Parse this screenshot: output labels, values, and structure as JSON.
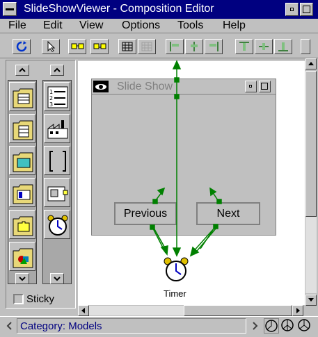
{
  "window": {
    "title": "SlideShowViewer - Composition Editor"
  },
  "menu": [
    "File",
    "Edit",
    "View",
    "Options",
    "Tools",
    "Help"
  ],
  "palette": {
    "sticky_label": "Sticky"
  },
  "canvas": {
    "slide_window_title": "Slide Show",
    "previous_button": "Previous",
    "next_button": "Next",
    "timer_label": "Timer"
  },
  "status": {
    "category": "Category: Models"
  },
  "colors": {
    "titlebar": "#000080",
    "connection": "#008000",
    "background": "#c0c0c0"
  }
}
